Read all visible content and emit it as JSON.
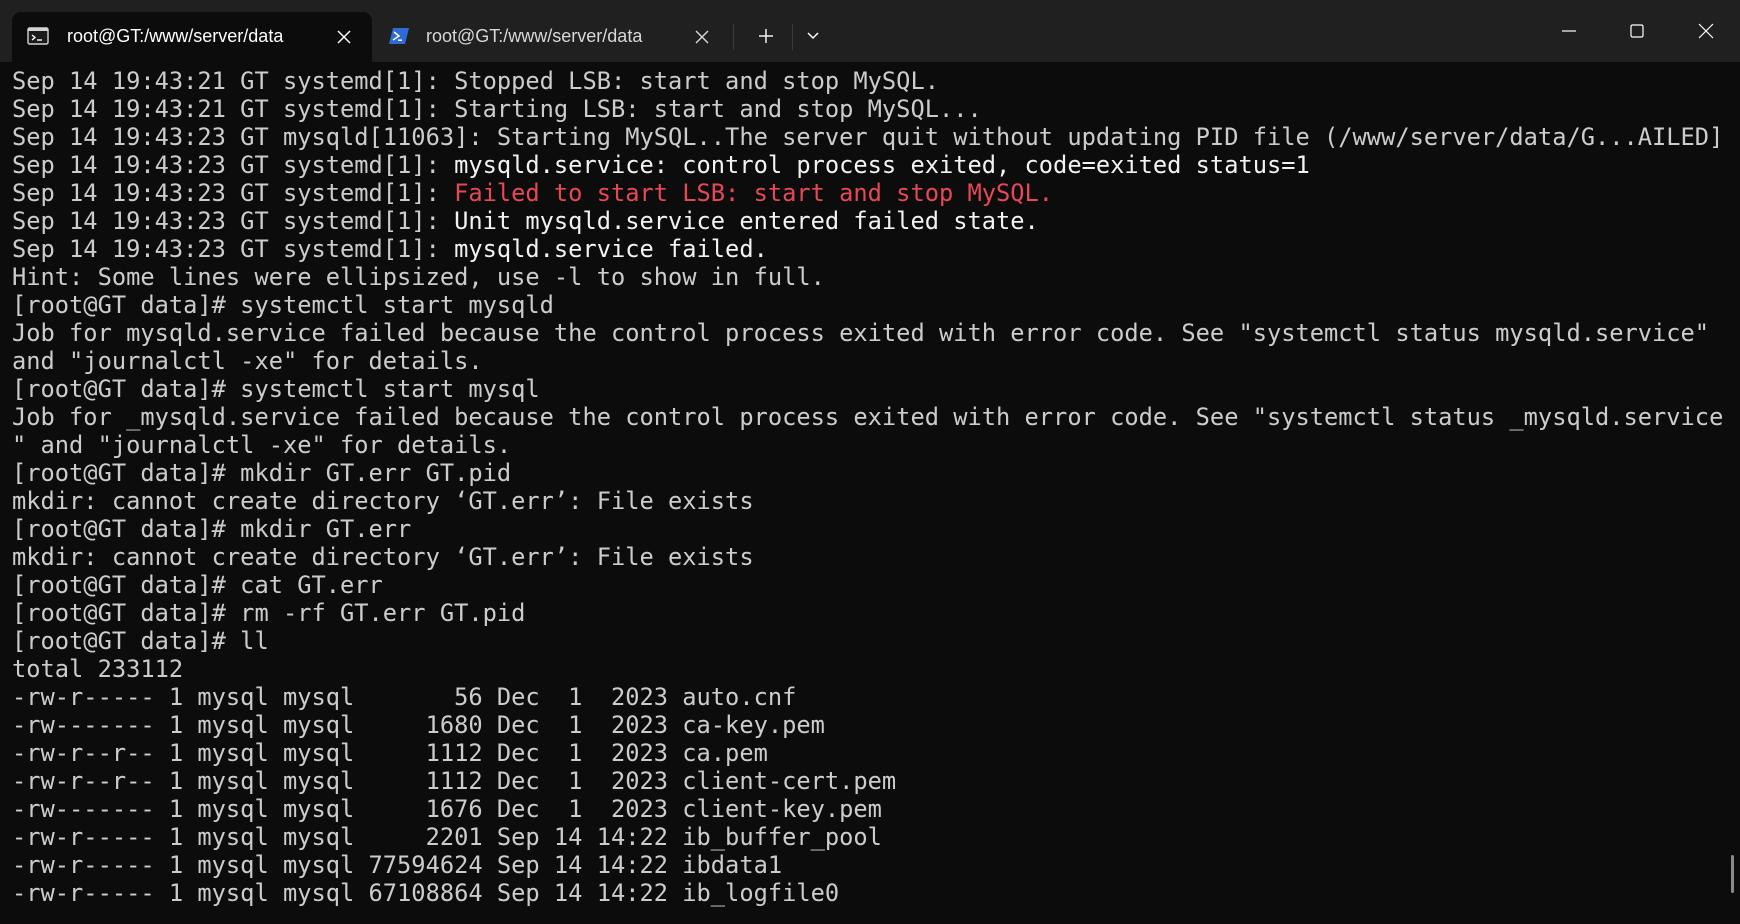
{
  "tabs": [
    {
      "label": "root@GT:/www/server/data",
      "icon": "terminal-icon",
      "active": true
    },
    {
      "label": "root@GT:/www/server/data",
      "icon": "powershell-icon",
      "active": false
    }
  ],
  "titlebar": {
    "new_tab_icon": "plus-icon",
    "dropdown_icon": "chevron-down-icon",
    "window_controls": [
      "minimize-icon",
      "maximize-icon",
      "close-icon"
    ]
  },
  "colors": {
    "background": "#0c0c0c",
    "titlebar": "#202020",
    "text": "#cccccc",
    "bright_text": "#f2f2f2",
    "error": "#e74856"
  },
  "terminal": {
    "lines": [
      {
        "text": "Sep 14 19:43:21 GT systemd[1]: Stopped LSB: start and stop MySQL."
      },
      {
        "text": "Sep 14 19:43:21 GT systemd[1]: Starting LSB: start and stop MySQL..."
      },
      {
        "text": "Sep 14 19:43:23 GT mysqld[11063]: Starting MySQL..The server quit without updating PID file (/www/server/data/G...AILED]"
      },
      {
        "prefix": "Sep 14 19:43:23 GT systemd[1]: ",
        "highlight": "mysqld.service: control process exited, code=exited status=1"
      },
      {
        "prefix": "Sep 14 19:43:23 GT systemd[1]: ",
        "error": "Failed to start LSB: start and stop MySQL."
      },
      {
        "prefix": "Sep 14 19:43:23 GT systemd[1]: ",
        "highlight": "Unit mysqld.service entered failed state."
      },
      {
        "prefix": "Sep 14 19:43:23 GT systemd[1]: ",
        "highlight": "mysqld.service failed."
      },
      {
        "text": "Hint: Some lines were ellipsized, use -l to show in full."
      },
      {
        "text": "[root@GT data]# systemctl start mysqld"
      },
      {
        "text": "Job for mysqld.service failed because the control process exited with error code. See \"systemctl status mysqld.service\""
      },
      {
        "text": "and \"journalctl -xe\" for details."
      },
      {
        "text": "[root@GT data]# systemctl start mysql"
      },
      {
        "text": "Job for _mysqld.service failed because the control process exited with error code. See \"systemctl status _mysqld.service"
      },
      {
        "text": "\" and \"journalctl -xe\" for details."
      },
      {
        "text": "[root@GT data]# mkdir GT.err GT.pid"
      },
      {
        "text": "mkdir: cannot create directory ‘GT.err’: File exists"
      },
      {
        "text": "[root@GT data]# mkdir GT.err"
      },
      {
        "text": "mkdir: cannot create directory ‘GT.err’: File exists"
      },
      {
        "text": "[root@GT data]# cat GT.err"
      },
      {
        "text": "[root@GT data]# rm -rf GT.err GT.pid"
      },
      {
        "text": "[root@GT data]# ll"
      },
      {
        "text": "total 233112"
      },
      {
        "text": "-rw-r----- 1 mysql mysql       56 Dec  1  2023 auto.cnf"
      },
      {
        "text": "-rw------- 1 mysql mysql     1680 Dec  1  2023 ca-key.pem"
      },
      {
        "text": "-rw-r--r-- 1 mysql mysql     1112 Dec  1  2023 ca.pem"
      },
      {
        "text": "-rw-r--r-- 1 mysql mysql     1112 Dec  1  2023 client-cert.pem"
      },
      {
        "text": "-rw------- 1 mysql mysql     1676 Dec  1  2023 client-key.pem"
      },
      {
        "text": "-rw-r----- 1 mysql mysql     2201 Sep 14 14:22 ib_buffer_pool"
      },
      {
        "text": "-rw-r----- 1 mysql mysql 77594624 Sep 14 14:22 ibdata1"
      },
      {
        "text": "-rw-r----- 1 mysql mysql 67108864 Sep 14 14:22 ib_logfile0"
      }
    ]
  }
}
